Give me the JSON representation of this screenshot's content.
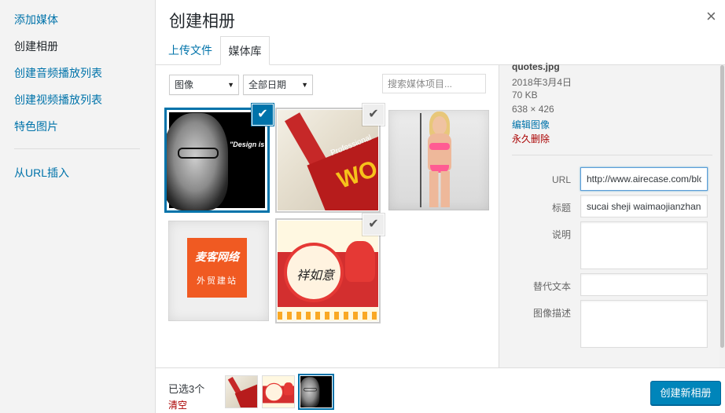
{
  "menu": {
    "items": [
      {
        "label": "添加媒体"
      },
      {
        "label": "创建相册"
      },
      {
        "label": "创建音频播放列表"
      },
      {
        "label": "创建视频播放列表"
      },
      {
        "label": "特色图片"
      },
      {
        "label": "从URL插入"
      }
    ]
  },
  "modal": {
    "title": "创建相册",
    "close_symbol": "×"
  },
  "tabs": [
    {
      "label": "上传文件"
    },
    {
      "label": "媒体库"
    }
  ],
  "filters": {
    "type": "图像",
    "date": "全部日期",
    "search_placeholder": "搜索媒体项目..."
  },
  "grid": {
    "items": [
      {
        "name": "quote image",
        "checked": true,
        "focused": true,
        "quote": "\"Design is n just what it like and fe like. Design how it work"
      },
      {
        "name": "book cover",
        "checked": true,
        "book_w": "WO",
        "book_pro": "Professional"
      },
      {
        "name": "model photo",
        "checked": false
      },
      {
        "name": "logo tile",
        "checked": false,
        "logo_text": "麦客网络",
        "logo_sub": "外贸建站"
      },
      {
        "name": "festive card",
        "checked": true,
        "callig": "祥如意"
      }
    ],
    "check_glyph": "✔"
  },
  "details": {
    "filename": "quotes.jpg",
    "date": "2018年3月4日",
    "size": "70 KB",
    "dimensions": "638 × 426",
    "edit_label": "编辑图像",
    "delete_label": "永久删除",
    "url_label": "URL",
    "url_value": "http://www.airecase.com/blog/wp-content/uploads/quotes.jpg",
    "title_label": "标题",
    "title_value": "sucai sheji waimaojianzhan",
    "caption_label": "说明",
    "caption_value": "",
    "alt_label": "替代文本",
    "alt_value": "",
    "desc_label": "图像描述",
    "desc_value": ""
  },
  "toolbar": {
    "selected_count": "已选3个",
    "clear_label": "清空",
    "create_button": "创建新相册"
  },
  "colors": {
    "accent": "#0073aa",
    "button": "#0085ba",
    "danger": "#a00"
  }
}
